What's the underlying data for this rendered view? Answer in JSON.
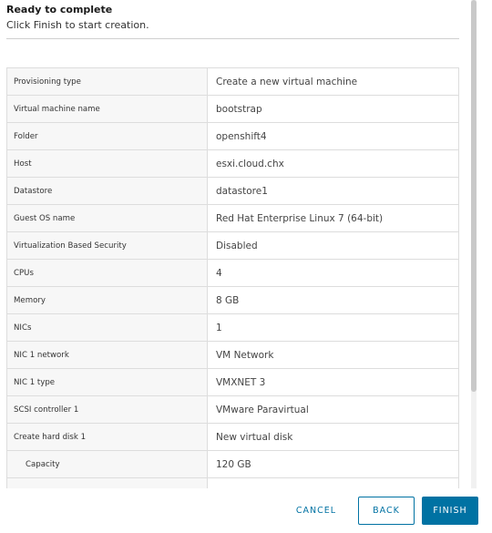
{
  "header": {
    "title": "Ready to complete",
    "subtitle": "Click Finish to start creation."
  },
  "summary_rows": [
    {
      "key": "Provisioning type",
      "value": "Create a new virtual machine"
    },
    {
      "key": "Virtual machine name",
      "value": "bootstrap"
    },
    {
      "key": "Folder",
      "value": "openshift4"
    },
    {
      "key": "Host",
      "value": "esxi.cloud.chx"
    },
    {
      "key": "Datastore",
      "value": "datastore1"
    },
    {
      "key": "Guest OS name",
      "value": "Red Hat Enterprise Linux 7 (64-bit)"
    },
    {
      "key": "Virtualization Based Security",
      "value": "Disabled"
    },
    {
      "key": "CPUs",
      "value": "4"
    },
    {
      "key": "Memory",
      "value": "8 GB"
    },
    {
      "key": "NICs",
      "value": "1"
    },
    {
      "key": "NIC 1 network",
      "value": "VM Network"
    },
    {
      "key": "NIC 1 type",
      "value": "VMXNET 3"
    },
    {
      "key": "SCSI controller 1",
      "value": "VMware Paravirtual"
    },
    {
      "key": "Create hard disk 1",
      "value": "New virtual disk"
    },
    {
      "key": "Capacity",
      "value": "120 GB"
    },
    {
      "key": "",
      "value": ""
    }
  ],
  "buttons": {
    "cancel": "CANCEL",
    "back": "BACK",
    "finish": "FINISH"
  },
  "colors": {
    "accent": "#0072a3",
    "key_cell_bg": "#f7f7f7",
    "border": "#dddddd"
  }
}
